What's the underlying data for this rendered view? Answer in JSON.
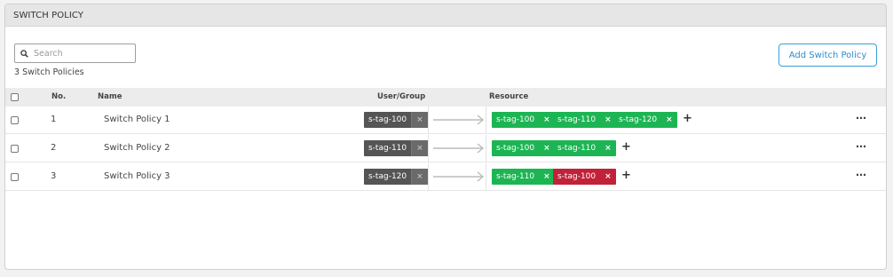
{
  "panel": {
    "title": "SWITCH POLICY"
  },
  "search": {
    "placeholder": "Search",
    "value": ""
  },
  "count_label": "3 Switch Policies",
  "add_button": "Add Switch Policy",
  "columns": {
    "no": "No.",
    "name": "Name",
    "user_group": "User/Group",
    "resource": "Resource"
  },
  "rows": [
    {
      "no": "1",
      "name": "Switch Policy 1",
      "user": "s-tag-100",
      "resources": [
        {
          "label": "s-tag-100",
          "color": "#1db554"
        },
        {
          "label": "s-tag-110",
          "color": "#1db554"
        },
        {
          "label": "s-tag-120",
          "color": "#1db554"
        }
      ]
    },
    {
      "no": "2",
      "name": "Switch Policy 2",
      "user": "s-tag-110",
      "resources": [
        {
          "label": "s-tag-100",
          "color": "#1db554"
        },
        {
          "label": "s-tag-110",
          "color": "#1db554"
        }
      ]
    },
    {
      "no": "3",
      "name": "Switch Policy 3",
      "user": "s-tag-120",
      "resources": [
        {
          "label": "s-tag-110",
          "color": "#1db554"
        },
        {
          "label": "s-tag-100",
          "color": "#c2213a"
        }
      ]
    }
  ],
  "glyphs": {
    "remove": "×",
    "add": "+",
    "more": "⋯"
  },
  "colors": {
    "accent": "#2b8ccd",
    "allow": "#1db554",
    "deny": "#c2213a",
    "user_tag": "#555555"
  }
}
